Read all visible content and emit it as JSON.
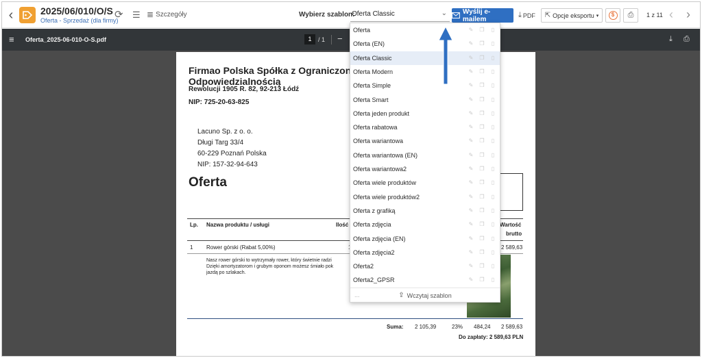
{
  "toolbar": {
    "doc_number": "2025/06/010/O/S",
    "doc_subtitle": "Oferta - Sprzedaż (dla firmy)",
    "details_label": "Szczegóły",
    "template_label": "Wybierz szablon:",
    "template_value": "Oferta Classic",
    "email_label": "Wyślij e-mailem",
    "pdf_label": "PDF",
    "export_label": "Opcje eksportu",
    "pager": "1 z 11"
  },
  "viewer": {
    "file_name": "Oferta_2025-06-010-O-S.pdf",
    "page_current": "1",
    "page_total": "/ 1"
  },
  "document": {
    "company_line1": "Firmao Polska Spółka z Ograniczon",
    "company_line2": "Odpowiedzialnością",
    "company_address": "Rewolucji 1905 R. 82, 92-213 Łódź",
    "company_nip": "NIP: 725-20-63-825",
    "client_name": "Lacuno Sp. z o. o.",
    "client_street": "Długi Targ 33/4",
    "client_city": "60-229 Poznań Polska",
    "client_nip": "NIP: 157-32-94-643",
    "heading": "Oferta",
    "col_lp": "Lp.",
    "col_name": "Nazwa produktu / usługi",
    "col_qty": "Ilość",
    "col_value_1": "Wartość",
    "col_value_2": "brutto",
    "row_lp": "1",
    "row_name": "Rower górski (Rabat 5,00%)",
    "row_qty": "1",
    "row_value": "2 589,63",
    "row_desc_1": "Nasz rower górski to wytrzymały rower, który świetnie radzi",
    "row_desc_2": "Dzięki amortyzatorom i grubym oponom możesz śmiało pok",
    "row_desc_3": "jazdą po szlakach.",
    "sum_label": "Suma:",
    "sum_net": "2 105,39",
    "sum_rate": "23%",
    "sum_vat": "484,24",
    "sum_gross": "2 589,63",
    "to_pay": "Do zapłaty: 2 589,63 PLN"
  },
  "dropdown": {
    "items": [
      "Oferta",
      "Oferta (EN)",
      "Oferta Classic",
      "Oferta Modern",
      "Oferta Simple",
      "Oferta Smart",
      "Oferta jeden produkt",
      "Oferta rabatowa",
      "Oferta wariantowa",
      "Oferta wariantowa (EN)",
      "Oferta wariantowa2",
      "Oferta wiele produktów",
      "Oferta wiele produktów2",
      "Oferta z grafiką",
      "Oferta zdjęcia",
      "Oferta zdjęcia (EN)",
      "Oferta zdjęcia2",
      "Oferta2",
      "Oferta2_GPSR"
    ],
    "selected": "Oferta Classic",
    "load_label": "Wczytaj szablon",
    "more": "..."
  },
  "colors": {
    "accent": "#2f6fc2",
    "badge": "#f0a032",
    "viewer_bg": "#4b4b4b",
    "viewer_bar": "#323639"
  }
}
